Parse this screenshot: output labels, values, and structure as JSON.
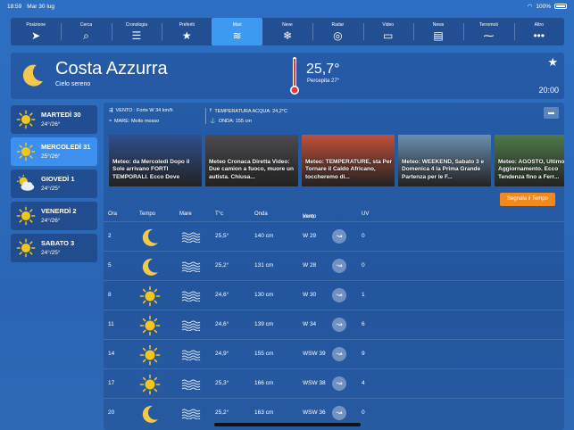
{
  "status": {
    "time": "18:59",
    "date": "Mar 30 lug",
    "battery": "100%"
  },
  "nav": [
    {
      "label": "Posizione",
      "icon": "location-arrow-icon",
      "glyph": "➤"
    },
    {
      "label": "Cerca",
      "icon": "search-icon",
      "glyph": "⌕"
    },
    {
      "label": "Cronologia",
      "icon": "history-icon",
      "glyph": "☰"
    },
    {
      "label": "Preferiti",
      "icon": "star-icon",
      "glyph": "★"
    },
    {
      "label": "Mari",
      "icon": "waves-icon",
      "glyph": "≋"
    },
    {
      "label": "Neve",
      "icon": "snowflake-icon",
      "glyph": "❄"
    },
    {
      "label": "Radar",
      "icon": "radar-icon",
      "glyph": "◎"
    },
    {
      "label": "Video",
      "icon": "tv-icon",
      "glyph": "▭"
    },
    {
      "label": "News",
      "icon": "newspaper-icon",
      "glyph": "▤"
    },
    {
      "label": "Terremoti",
      "icon": "seismograph-icon",
      "glyph": "⁓"
    },
    {
      "label": "Altro",
      "icon": "more-icon",
      "glyph": "•••"
    }
  ],
  "header": {
    "city": "Costa Azzurra",
    "sky": "Cielo sereno",
    "temp": "25,7°",
    "feel": "Percepita 27°",
    "clock": "20:00"
  },
  "days": [
    {
      "name": "MARTEDÌ 30",
      "range": "24°/26°",
      "icon": "sun"
    },
    {
      "name": "MERCOLEDÌ 31",
      "range": "25°/26°",
      "icon": "sun"
    },
    {
      "name": "GIOVEDÌ 1",
      "range": "24°/25°",
      "icon": "sun-cloud"
    },
    {
      "name": "VENERDÌ 2",
      "range": "24°/26°",
      "icon": "sun"
    },
    {
      "name": "SABATO 3",
      "range": "24°/25°",
      "icon": "sun"
    }
  ],
  "sea_info": {
    "wind": "VENTO : Forte W 34 km/h",
    "sea": "MARE: Molto mosso",
    "water_temp": "TEMPERATURA ACQUA: 24,2°C",
    "wave": "ONDA: 155 cm"
  },
  "news": [
    {
      "text": "Meteo: da Mercoledì Dopo il Sole arrivano FORTI TEMPORALI. Ecco Dove",
      "color": "#2f4f8f"
    },
    {
      "text": "Meteo Cronaca Diretta Video: Due camion a fuoco, muore un autista. Chiusa...",
      "color": "#4a4a50"
    },
    {
      "text": "Meteo: TEMPERATURE, sta Per Tornare il Caldo Africano, toccheremo di...",
      "color": "#c0503a"
    },
    {
      "text": "Meteo: WEEKEND, Sabato 3 e Domenica 4 la Prima Grande Partenza per le F...",
      "color": "#6a8fb0"
    },
    {
      "text": "Meteo: AGOSTO, Ultimo Aggiornamento. Ecco Tendenza fino a Ferr...",
      "color": "#4f7a4a"
    }
  ],
  "report_button": "Segnala il Tempo",
  "table": {
    "headers": {
      "hour": "Ora",
      "weather": "Tempo",
      "sea": "Mare",
      "temp": "T°c",
      "wave": "Onda",
      "wind": "Vento",
      "wind_unit": "(km/h)",
      "uv": "UV"
    },
    "rows": [
      {
        "hour": "2",
        "icon": "moon",
        "temp": "25,5°",
        "wave": "140 cm",
        "wind": "W 29",
        "uv": "0"
      },
      {
        "hour": "5",
        "icon": "moon",
        "temp": "25,2°",
        "wave": "131 cm",
        "wind": "W 28",
        "uv": "0"
      },
      {
        "hour": "8",
        "icon": "sun",
        "temp": "24,6°",
        "wave": "130 cm",
        "wind": "W 30",
        "uv": "1"
      },
      {
        "hour": "11",
        "icon": "sun",
        "temp": "24,6°",
        "wave": "139 cm",
        "wind": "W 34",
        "uv": "6"
      },
      {
        "hour": "14",
        "icon": "sun",
        "temp": "24,9°",
        "wave": "155 cm",
        "wind": "WSW 39",
        "uv": "9"
      },
      {
        "hour": "17",
        "icon": "sun",
        "temp": "25,3°",
        "wave": "166 cm",
        "wind": "WSW 38",
        "uv": "4"
      },
      {
        "hour": "20",
        "icon": "moon",
        "temp": "25,2°",
        "wave": "163 cm",
        "wind": "WSW 36",
        "uv": "0"
      }
    ]
  },
  "colors": {
    "accent": "#3d9af0",
    "button": "#f08a1c",
    "sun": "#f5c518",
    "moon": "#f2c94c"
  }
}
